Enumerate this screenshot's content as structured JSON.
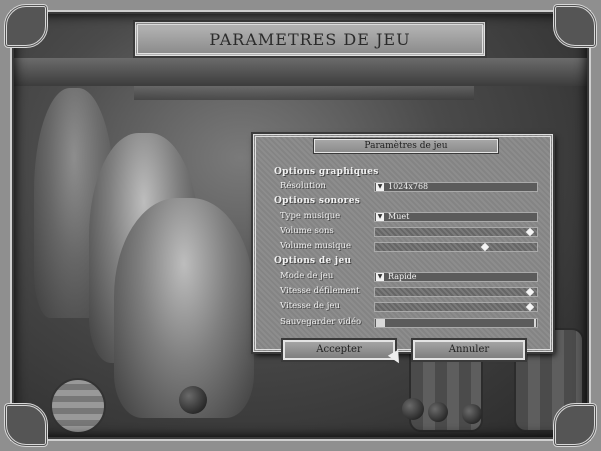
{
  "title": "PARAMETRES DE JEU",
  "dialog": {
    "title": "Paramètres de jeu",
    "sections": {
      "graphics": "Options graphiques",
      "sound": "Options sonores",
      "game": "Options de jeu"
    },
    "rows": {
      "resolution": {
        "label": "Résolution",
        "value": "1024x768"
      },
      "music_type": {
        "label": "Type musique",
        "value": "Muet"
      },
      "volume_sounds": {
        "label": "Volume sons",
        "level": 1.0
      },
      "volume_music": {
        "label": "Volume musique",
        "level": 0.7
      },
      "game_mode": {
        "label": "Mode de jeu",
        "value": "Rapide"
      },
      "scroll_speed": {
        "label": "Vitesse défilement",
        "level": 1.0
      },
      "game_speed": {
        "label": "Vitesse de jeu",
        "level": 1.0
      },
      "save_video": {
        "label": "Sauvegarder vidéo"
      }
    }
  },
  "buttons": {
    "accept": "Accepter",
    "cancel": "Annuler"
  }
}
